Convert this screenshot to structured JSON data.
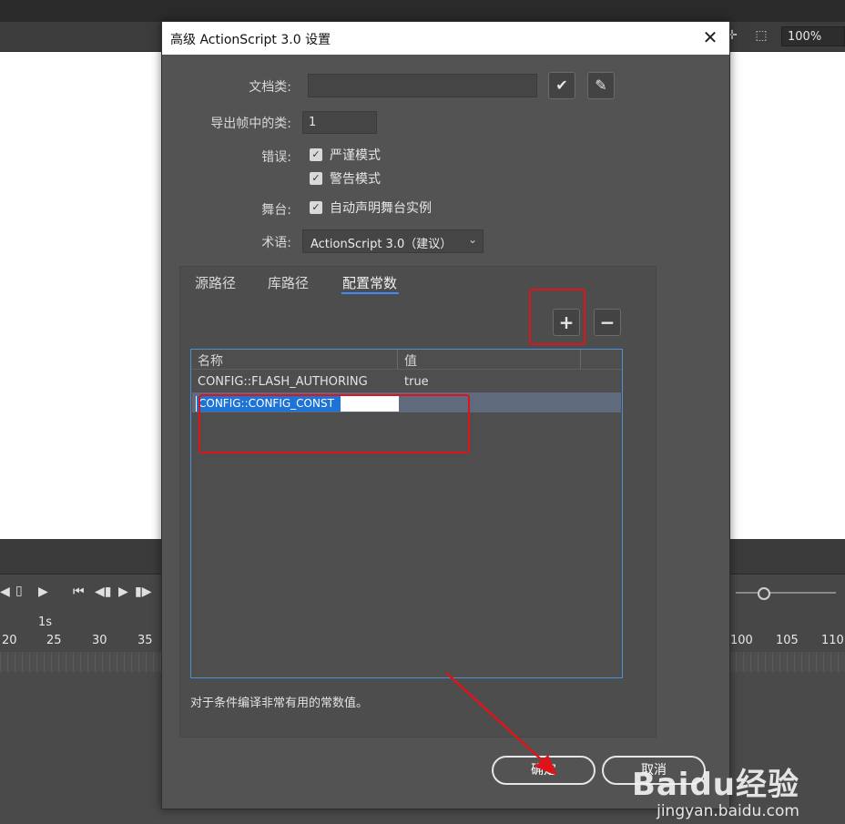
{
  "app": {
    "zoom": "100%",
    "timeline_label": "1s",
    "ruler_ticks_left": [
      "20",
      "25",
      "30",
      "35"
    ],
    "ruler_ticks_right": [
      "100",
      "105",
      "110"
    ],
    "icons": [
      "crosshair-icon",
      "clip-icon"
    ]
  },
  "dialog": {
    "title": "高级 ActionScript 3.0 设置",
    "close": "✕",
    "document_class_label": "文档类:",
    "document_class_value": "",
    "export_frame_label": "导出帧中的类:",
    "export_frame_value": "1",
    "errors_label": "错误:",
    "strict_mode": "严谨模式",
    "warnings_mode": "警告模式",
    "stage_label": "舞台:",
    "auto_declare": "自动声明舞台实例",
    "dialect_label": "术语:",
    "dialect_value": "ActionScript 3.0（建议）",
    "tabs": [
      "源路径",
      "库路径",
      "配置常数"
    ],
    "active_tab": "配置常数",
    "table": {
      "headers": [
        "名称",
        "值"
      ],
      "rows": [
        {
          "name": "CONFIG::FLASH_AUTHORING",
          "value": "true"
        }
      ],
      "editing_value": "CONFIG::CONFIG_CONST"
    },
    "hint": "对于条件编译非常有用的常数值。",
    "ok": "确定",
    "cancel": "取消"
  },
  "watermark": {
    "brand": "Baidu经验",
    "url": "jingyan.baidu.com"
  },
  "colors": {
    "highlight": "#e0131a",
    "tab_accent": "#3b8cff",
    "table_border": "#4a90d9"
  }
}
